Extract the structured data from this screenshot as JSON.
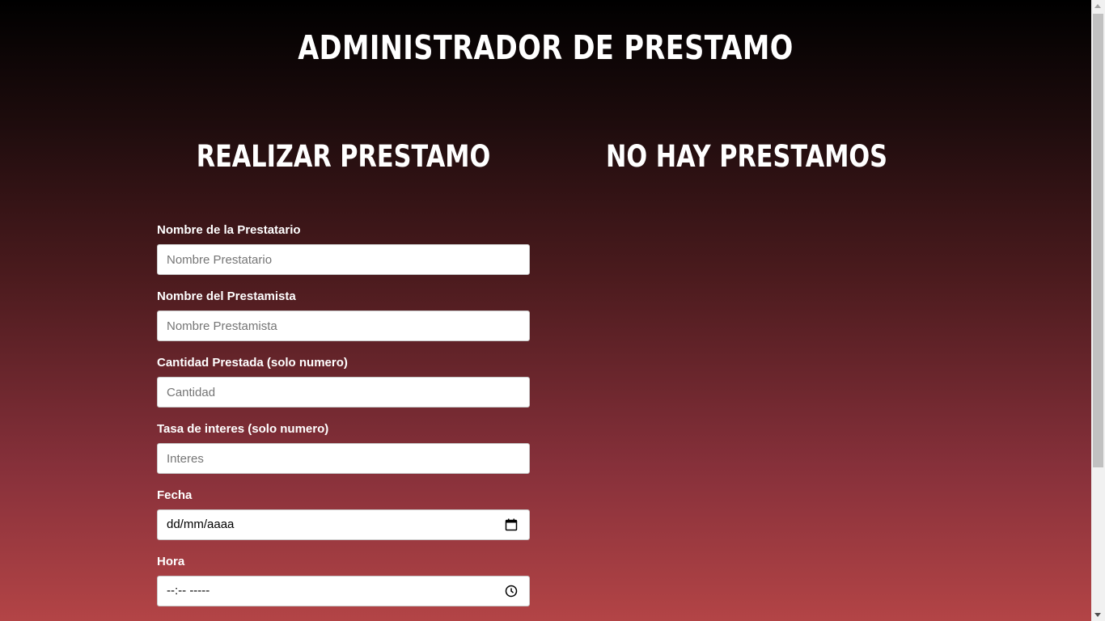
{
  "header": {
    "title": "Administrador de Prestamo"
  },
  "sections": {
    "form_title": "Realizar Prestamo",
    "list_title": "No hay prestamos"
  },
  "form": {
    "borrower": {
      "label": "Nombre de la Prestatario",
      "placeholder": "Nombre Prestatario"
    },
    "lender": {
      "label": "Nombre del Prestamista",
      "placeholder": "Nombre Prestamista"
    },
    "amount": {
      "label": "Cantidad Prestada (solo numero)",
      "placeholder": "Cantidad"
    },
    "rate": {
      "label": "Tasa de interes (solo numero)",
      "placeholder": "Interes"
    },
    "date": {
      "label": "Fecha",
      "value": "dd/mm/aaaa",
      "icon": "calendar-icon"
    },
    "time": {
      "label": "Hora",
      "value": "--:-- -----",
      "icon": "clock-icon"
    }
  },
  "colors": {
    "gradient_top": "#000000",
    "gradient_bottom": "#b34446",
    "text": "#ffffff"
  }
}
